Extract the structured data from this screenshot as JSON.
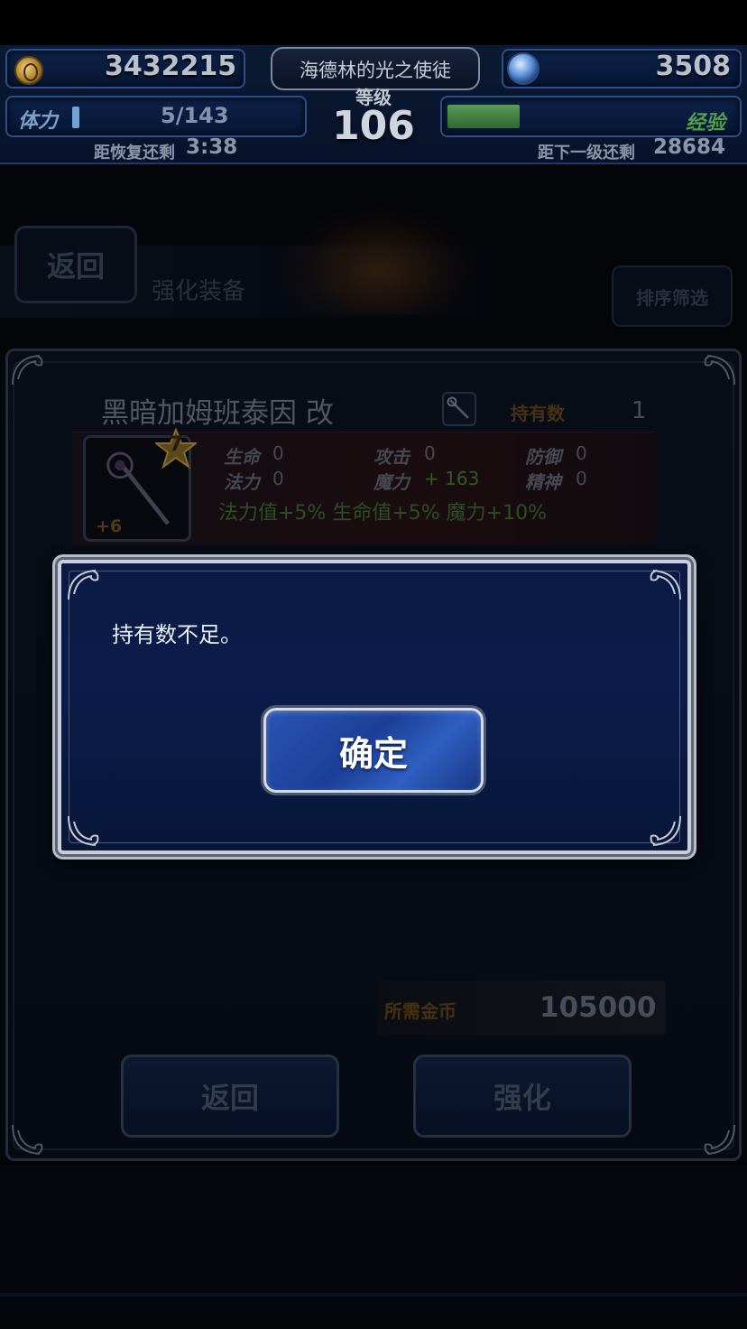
{
  "hud": {
    "coins": "3432215",
    "gems": "3508",
    "player_title": "海德林的光之使徒",
    "level_label": "等级",
    "level": "106",
    "stamina_label": "体力",
    "stamina": "5/143",
    "stamina_fraction": 0.035,
    "recover_label": "距恢复还剩",
    "recover_time": "3:38",
    "exp_label": "经验",
    "exp_fraction": 0.25,
    "next_level_label": "距下一级还剩",
    "next_level_exp": "28684"
  },
  "header": {
    "back_label": "返回",
    "page_title": "强化装备",
    "sort_label": "排序筛选"
  },
  "item": {
    "name": "黑暗加姆班泰因 改",
    "type_icon": "staff-icon",
    "owned_label": "持有数",
    "owned": "1",
    "rarity": "7",
    "plus": "+6",
    "stats": {
      "hp_label": "生命",
      "hp": "0",
      "atk_label": "攻击",
      "atk": "0",
      "def_label": "防御",
      "def": "0",
      "mp_label": "法力",
      "mp": "0",
      "mag_label": "魔力",
      "mag": "+ 163",
      "spr_label": "精神",
      "spr": "0"
    },
    "bonus": "法力值+5% 生命值+5% 魔力+10%"
  },
  "cost": {
    "label": "所需金币",
    "value": "105000"
  },
  "buttons": {
    "back": "返回",
    "enhance": "强化"
  },
  "dialog": {
    "message": "持有数不足。",
    "ok_label": "确定"
  },
  "colors": {
    "accent_blue": "#1b3f96",
    "exp_green": "#4fa04a",
    "bonus_green": "#447a33",
    "gold_label": "#6b4c1c"
  }
}
